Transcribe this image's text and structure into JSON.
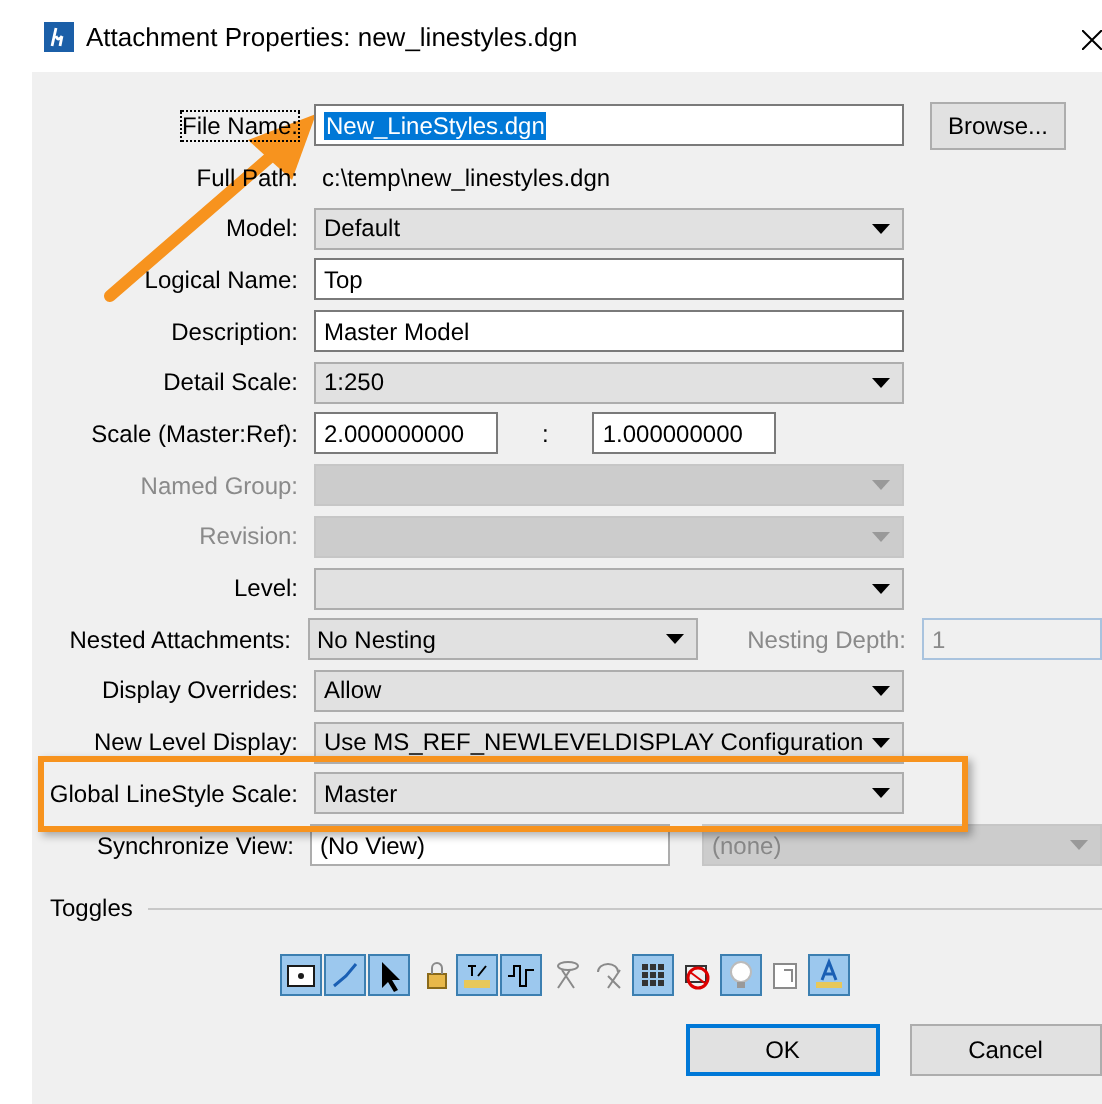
{
  "window": {
    "title": "Attachment Properties: new_linestyles.dgn"
  },
  "rows": [
    {
      "kind": "text",
      "label": "File Name:",
      "value": "New_LineStyles.dgn",
      "focused": true,
      "button": "Browse..."
    },
    {
      "kind": "static",
      "label": "Full Path:",
      "value": "c:\\temp\\new_linestyles.dgn"
    },
    {
      "kind": "combo",
      "label": "Model:",
      "value": "Default",
      "disabled": false
    },
    {
      "kind": "text",
      "label": "Logical Name:",
      "value": "Top"
    },
    {
      "kind": "text",
      "label": "Description:",
      "value": "Master Model"
    },
    {
      "kind": "combo",
      "label": "Detail Scale:",
      "value": "1:250",
      "disabled": false
    },
    {
      "kind": "ratio",
      "label": "Scale (Master:Ref):",
      "value": "2.000000000",
      "separator": ":",
      "value2": "1.000000000"
    },
    {
      "kind": "combo",
      "label": "Named Group:",
      "disabled": true
    },
    {
      "kind": "combo",
      "label": "Revision:",
      "disabled": true
    },
    {
      "kind": "combo",
      "label": "Level:",
      "disabled": false
    },
    {
      "kind": "nested",
      "label": "Nested Attachments:",
      "value": "No Nesting",
      "label2": "Nesting Depth:",
      "value2": "1"
    },
    {
      "kind": "combo",
      "label": "Display Overrides:",
      "value": "Allow",
      "disabled": false
    },
    {
      "kind": "combo",
      "label": "New Level Display:",
      "value": "Use MS_REF_NEWLEVELDISPLAY Configuration",
      "disabled": false
    },
    {
      "kind": "combo",
      "label": "Global LineStyle Scale:",
      "value": "Master",
      "disabled": false,
      "highlighted": true
    },
    {
      "kind": "sync",
      "label": "Synchronize View:",
      "value": "(No View)",
      "value2": "(none)"
    }
  ],
  "toggles_title": "Toggles",
  "toggles": [
    {
      "on": true
    },
    {
      "on": true
    },
    {
      "on": true
    },
    {
      "on": false
    },
    {
      "on": true
    },
    {
      "on": true
    },
    {
      "on": false
    },
    {
      "on": false
    },
    {
      "on": true
    },
    {
      "on": false
    },
    {
      "on": true
    },
    {
      "on": false
    },
    {
      "on": true
    }
  ],
  "buttons": [
    {
      "label": "OK",
      "default": true
    },
    {
      "label": "Cancel",
      "default": false
    }
  ]
}
